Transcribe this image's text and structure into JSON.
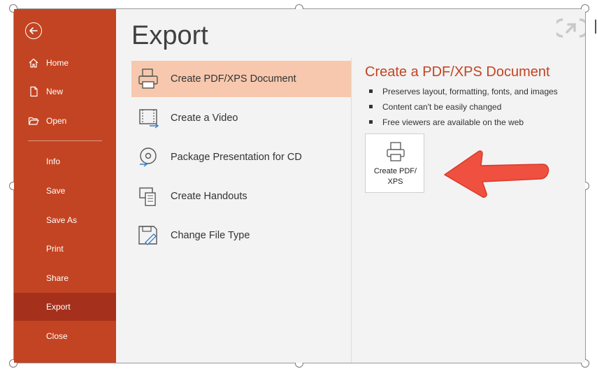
{
  "colors": {
    "sidebar": "#c34422",
    "sidebar_active": "#a5301b",
    "selected_option": "#f7c8ae",
    "accent_title": "#c34422",
    "arrow": "#f0503f"
  },
  "sidebar": {
    "back_icon": "back-arrow-icon",
    "items": [
      {
        "label": "Home",
        "icon": "home-icon"
      },
      {
        "label": "New",
        "icon": "new-document-icon"
      },
      {
        "label": "Open",
        "icon": "folder-open-icon"
      },
      {
        "label": "Info"
      },
      {
        "label": "Save"
      },
      {
        "label": "Save As"
      },
      {
        "label": "Print"
      },
      {
        "label": "Share"
      },
      {
        "label": "Export"
      },
      {
        "label": "Close"
      }
    ],
    "active": "Export"
  },
  "main": {
    "title": "Export",
    "options": [
      {
        "label": "Create PDF/XPS Document",
        "icon": "pdf-document-icon",
        "selected": true
      },
      {
        "label": "Create a Video",
        "icon": "video-icon"
      },
      {
        "label": "Package Presentation for CD",
        "icon": "cd-icon"
      },
      {
        "label": "Create Handouts",
        "icon": "handouts-icon"
      },
      {
        "label": "Change File Type",
        "icon": "change-file-type-icon"
      }
    ]
  },
  "detail": {
    "title": "Create a PDF/XPS Document",
    "bullets": [
      "Preserves layout, formatting, fonts, and images",
      "Content can't be easily changed",
      "Free viewers are available on the web"
    ],
    "button": {
      "line1": "Create PDF/",
      "line2": "XPS",
      "icon": "pdf-document-icon"
    }
  }
}
